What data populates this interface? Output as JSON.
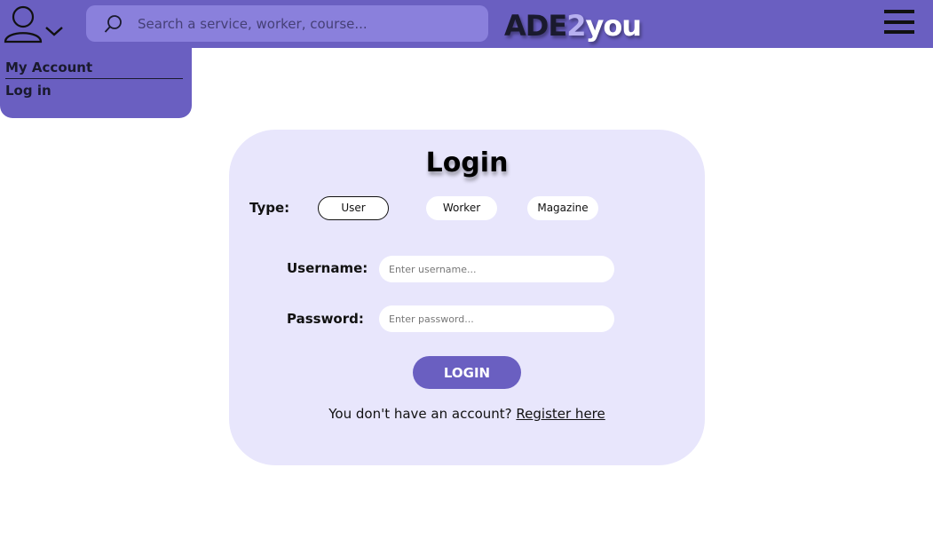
{
  "header": {
    "search_placeholder": "Search a service, worker, course...",
    "logo": {
      "part1": "ADE",
      "part2": "2",
      "part3": "you"
    },
    "user_icon": "user-icon",
    "menu_icon": "hamburger-menu-icon"
  },
  "account_menu": {
    "items": [
      {
        "label": "My Account"
      },
      {
        "label": "Log in"
      }
    ]
  },
  "login": {
    "title": "Login",
    "type_label": "Type:",
    "types": [
      {
        "label": "User",
        "selected": true
      },
      {
        "label": "Worker",
        "selected": false
      },
      {
        "label": "Magazine",
        "selected": false
      }
    ],
    "username_label": "Username:",
    "username_placeholder": "Enter username...",
    "password_label": "Password:",
    "password_placeholder": "Enter password...",
    "button_label": "LOGIN",
    "register_prompt": "You don't have an account?",
    "register_link": "Register here"
  },
  "colors": {
    "primary": "#6a5fc1",
    "search_bg": "#8a80dc",
    "card_bg": "#e8e6fc"
  }
}
